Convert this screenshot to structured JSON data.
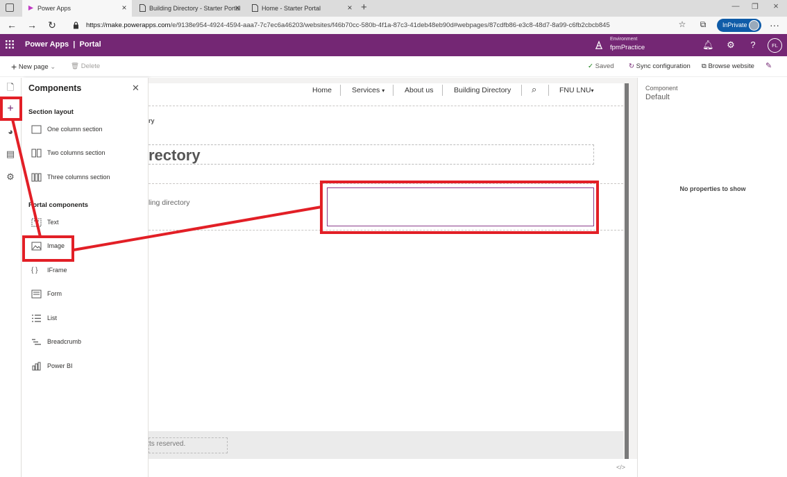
{
  "browser": {
    "tabs": [
      {
        "label": "Power Apps",
        "active": true
      },
      {
        "label": "Building Directory - Starter Portal",
        "active": false
      },
      {
        "label": "Home - Starter Portal",
        "active": false
      }
    ],
    "url_host": "https://make.powerapps.com",
    "url_path": "/e/9138e954-4924-4594-aaa7-7c7ec6a46203/websites/f46b70cc-580b-4f1a-87c3-41deb48eb90d#webpages/87cdfb86-e3c8-48d7-8a99-c6fb2cbcb845",
    "inprivate_label": "InPrivate"
  },
  "app_header": {
    "title": "Power Apps  |  Portal",
    "environment_label": "Environment",
    "environment_value": "fpmPractice",
    "user_initials": "FL"
  },
  "command_bar": {
    "new_page": "New page",
    "delete": "Delete",
    "saved": "Saved",
    "sync": "Sync configuration",
    "browse": "Browse website"
  },
  "components_pane": {
    "title": "Components",
    "section_layout_heading": "Section layout",
    "layout_items": [
      "One column section",
      "Two columns section",
      "Three columns section"
    ],
    "portal_components_heading": "Portal components",
    "portal_items": [
      "Text",
      "Image",
      "IFrame",
      "Form",
      "List",
      "Breadcrumb",
      "Power BI"
    ]
  },
  "canvas": {
    "nav": [
      "Home",
      "Services",
      "About us",
      "Building Directory",
      "FNU LNU"
    ],
    "breadcrumb_fragment": "ry",
    "heading_fragment": "rectory",
    "text_fragment": "ling directory",
    "footer_fragment": "ts reserved."
  },
  "properties": {
    "component_label": "Component",
    "component_value": "Default",
    "empty_message": "No properties to show"
  },
  "colors": {
    "brand": "#742774",
    "annotation": "#e21f26",
    "inprivate": "#0f5ca8"
  }
}
